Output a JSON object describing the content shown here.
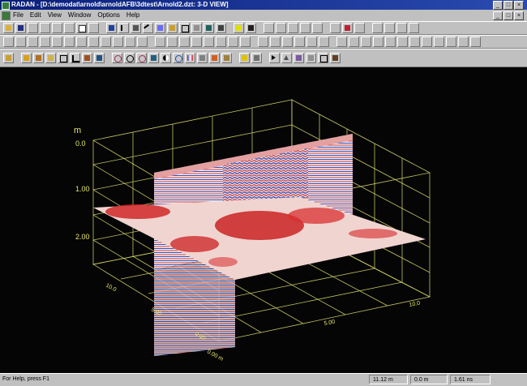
{
  "window": {
    "title": "RADAN - [D:\\demodat\\arnold\\arnoldAFB\\3dtest\\Arnold2.dzt: 3-D VIEW]"
  },
  "menu": [
    "File",
    "Edit",
    "View",
    "Window",
    "Options",
    "Help"
  ],
  "plot": {
    "axis_unit": "m",
    "depth_ticks": [
      "0.0",
      "1.00",
      "2.00"
    ],
    "front_axis_ticks": [
      "5.00",
      "10.0"
    ],
    "left_axis_ticks": [
      "10.0",
      "5.00",
      "0.00"
    ],
    "corner_label": "0.00 m"
  },
  "status": {
    "help": "For Help, press F1",
    "distance": "11.12 m",
    "offset": "0.0 m",
    "time": "1.61 ns"
  },
  "colors": {
    "background": "#050505",
    "grid": "#d8d86a",
    "radar_red": "#d02020",
    "radar_blue": "#2030b0"
  }
}
